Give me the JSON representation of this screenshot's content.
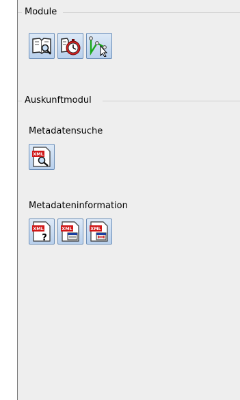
{
  "module_group": {
    "title": "Module",
    "buttons": [
      {
        "icon": "document-search-icon"
      },
      {
        "icon": "document-clock-icon"
      },
      {
        "icon": "map-select-icon"
      }
    ]
  },
  "auskunft_group": {
    "title": "Auskunftmodul",
    "search_label": "Metadatensuche",
    "info_label": "Metadateninformation",
    "xml_badge": "XML",
    "question_mark": "?"
  },
  "colors": {
    "panel_bg": "#eeeeee",
    "button_top": "#dde9f7",
    "button_bottom": "#b9d0ec",
    "xml_red": "#d01818",
    "clock_red": "#d42020",
    "line_green": "#1aa81a"
  }
}
